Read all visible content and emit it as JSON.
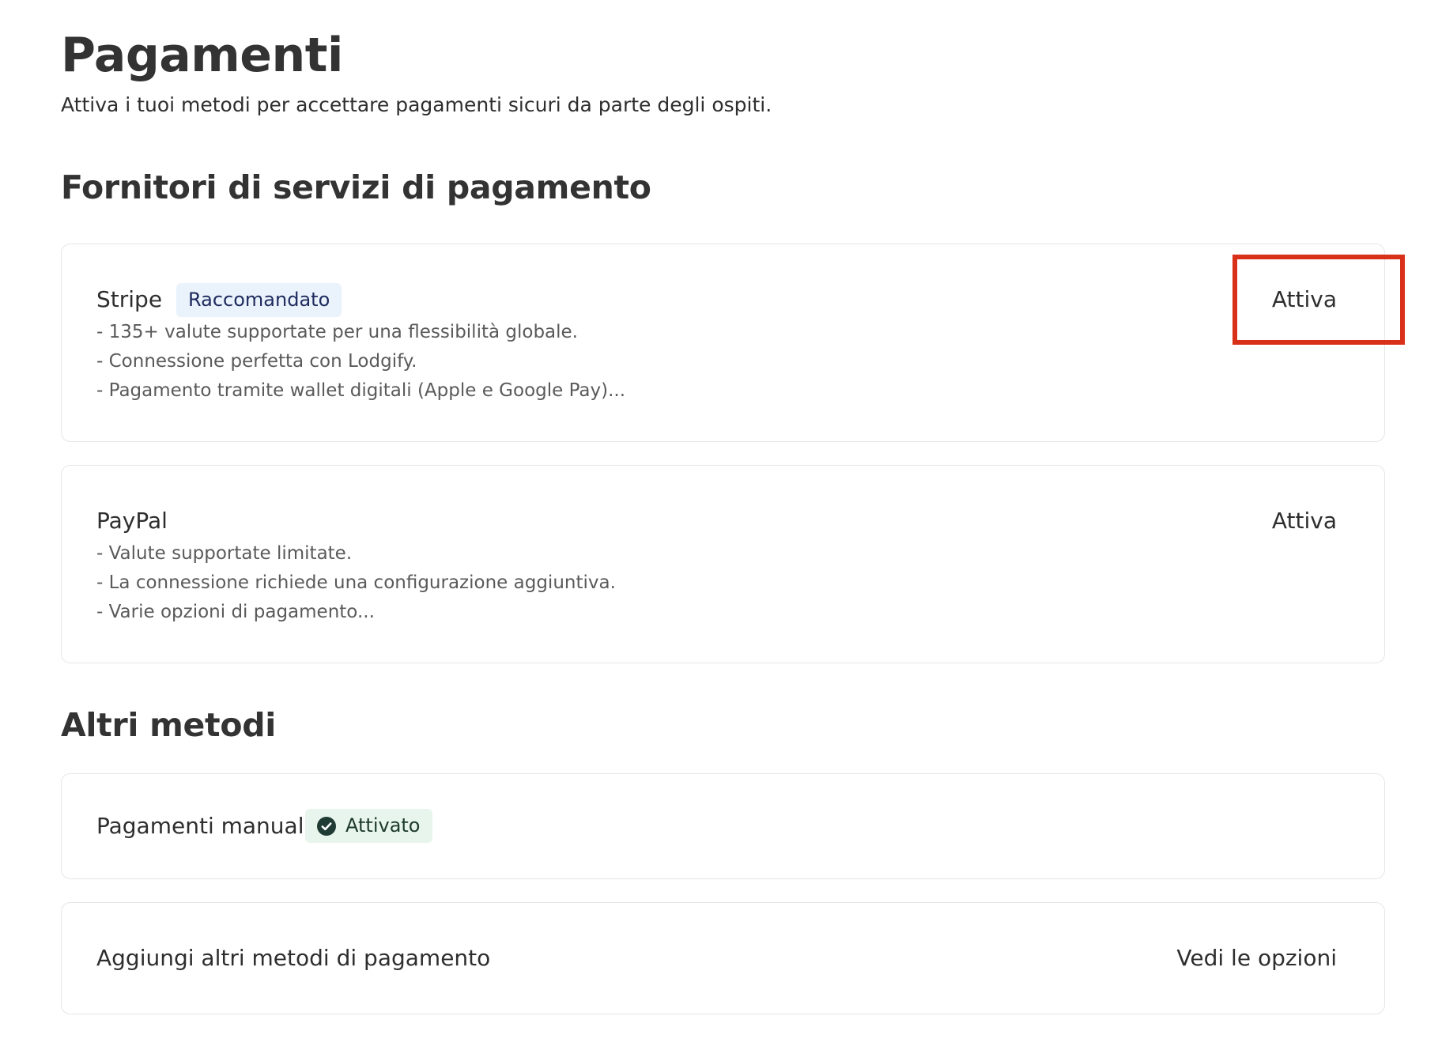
{
  "page": {
    "title": "Pagamenti",
    "subtitle": "Attiva i tuoi metodi per accettare pagamenti sicuri da parte degli ospiti."
  },
  "providers_section": {
    "title": "Fornitori di servizi di pagamento",
    "stripe": {
      "name": "Stripe",
      "badge": "Raccomandato",
      "features": [
        "- 135+ valute supportate per una flessibilità globale.",
        "- Connessione perfetta con Lodgify.",
        "- Pagamento tramite wallet digitali (Apple e Google Pay)..."
      ],
      "action_label": "Attiva"
    },
    "paypal": {
      "name": "PayPal",
      "features": [
        "- Valute supportate limitate.",
        "- La connessione richiede una configurazione aggiuntiva.",
        "- Varie opzioni di pagamento..."
      ],
      "action_label": "Attiva"
    }
  },
  "other_section": {
    "title": "Altri metodi",
    "manual": {
      "name": "Pagamenti manuali",
      "status_badge": "Attivato",
      "status_icon": "check-circle-icon"
    },
    "add_more": {
      "name": "Aggiungi altri metodi di pagamento",
      "action_label": "Vedi le opzioni"
    }
  },
  "colors": {
    "highlight": "#d9301a",
    "recommended_badge_bg": "#eaf2fb",
    "active_badge_bg": "#e8f5ec",
    "check_icon": "#1f3b33"
  }
}
